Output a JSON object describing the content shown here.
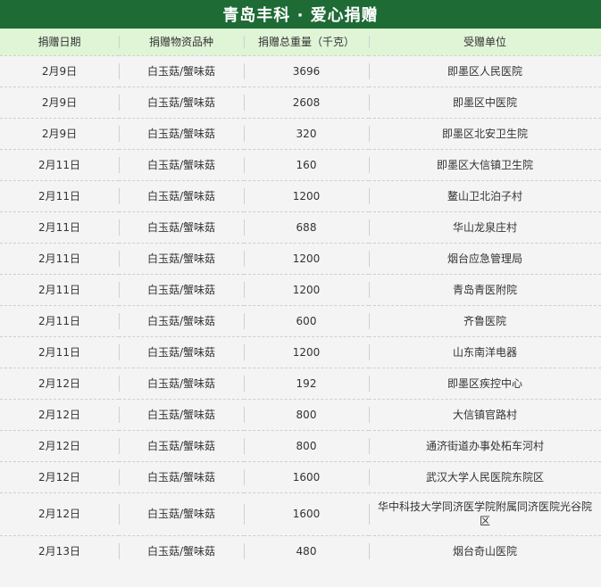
{
  "title": "青岛丰科 · 爱心捐赠",
  "columns": [
    "捐赠日期",
    "捐赠物资品种",
    "捐赠总重量（千克）",
    "受赠单位"
  ],
  "rows": [
    {
      "date": "2月9日",
      "item": "白玉菇/蟹味菇",
      "weight": "3696",
      "recipient": "即墨区人民医院"
    },
    {
      "date": "2月9日",
      "item": "白玉菇/蟹味菇",
      "weight": "2608",
      "recipient": "即墨区中医院"
    },
    {
      "date": "2月9日",
      "item": "白玉菇/蟹味菇",
      "weight": "320",
      "recipient": "即墨区北安卫生院"
    },
    {
      "date": "2月11日",
      "item": "白玉菇/蟹味菇",
      "weight": "160",
      "recipient": "即墨区大信镇卫生院"
    },
    {
      "date": "2月11日",
      "item": "白玉菇/蟹味菇",
      "weight": "1200",
      "recipient": "鳌山卫北泊子村"
    },
    {
      "date": "2月11日",
      "item": "白玉菇/蟹味菇",
      "weight": "688",
      "recipient": "华山龙泉庄村"
    },
    {
      "date": "2月11日",
      "item": "白玉菇/蟹味菇",
      "weight": "1200",
      "recipient": "烟台应急管理局"
    },
    {
      "date": "2月11日",
      "item": "白玉菇/蟹味菇",
      "weight": "1200",
      "recipient": "青岛青医附院"
    },
    {
      "date": "2月11日",
      "item": "白玉菇/蟹味菇",
      "weight": "600",
      "recipient": "齐鲁医院"
    },
    {
      "date": "2月11日",
      "item": "白玉菇/蟹味菇",
      "weight": "1200",
      "recipient": "山东南洋电器"
    },
    {
      "date": "2月12日",
      "item": "白玉菇/蟹味菇",
      "weight": "192",
      "recipient": "即墨区疾控中心"
    },
    {
      "date": "2月12日",
      "item": "白玉菇/蟹味菇",
      "weight": "800",
      "recipient": "大信镇官路村"
    },
    {
      "date": "2月12日",
      "item": "白玉菇/蟹味菇",
      "weight": "800",
      "recipient": "通济街道办事处柘车河村"
    },
    {
      "date": "2月12日",
      "item": "白玉菇/蟹味菇",
      "weight": "1600",
      "recipient": "武汉大学人民医院东院区"
    },
    {
      "date": "2月12日",
      "item": "白玉菇/蟹味菇",
      "weight": "1600",
      "recipient": "华中科技大学同济医学院附属同济医院光谷院区"
    },
    {
      "date": "2月13日",
      "item": "白玉菇/蟹味菇",
      "weight": "480",
      "recipient": "烟台奇山医院"
    }
  ],
  "colors": {
    "title_bg": "#1e6b35",
    "header_bg": "#dff5d6",
    "row_bg": "#f4f4f4"
  }
}
